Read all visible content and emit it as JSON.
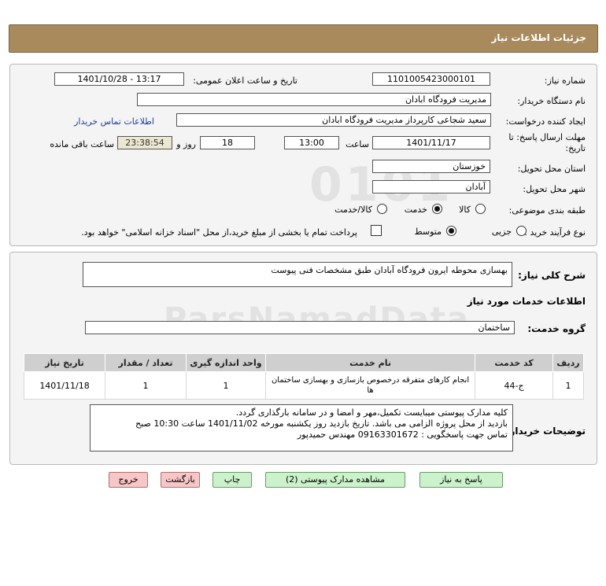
{
  "header": {
    "title": "جزئیات اطلاعات نیاز"
  },
  "form": {
    "need_number_label": "شماره نیاز:",
    "need_number": "1101005423000101",
    "announce_label": "تاریخ و ساعت اعلان عمومی:",
    "announce_value": "1401/10/28 - 13:17",
    "buyer_org_label": "نام دستگاه خریدار:",
    "buyer_org": "مدیریت فرودگاه ابادان",
    "creator_label": "ایجاد کننده درخواست:",
    "creator": "سعید شجاعی کارپرداز مدیریت فرودگاه ابادان",
    "contact_link": "اطلاعات تماس خریدار",
    "deadline_label_1": "مهلت ارسال پاسخ: تا",
    "deadline_label_2": "تاریخ:",
    "deadline_date": "1401/11/17",
    "time_label": "ساعت",
    "deadline_time": "13:00",
    "days_value": "18",
    "days_label": "روز و",
    "remaining_time": "23:38:54",
    "remaining_label": "ساعت باقی مانده",
    "province_label": "استان محل تحویل:",
    "province": "خوزستان",
    "city_label": "شهر محل تحویل:",
    "city": "آبادان",
    "category_label": "طبقه بندی موضوعی:",
    "category_options": [
      "کالا",
      "خدمت",
      "کالا/خدمت"
    ],
    "category_selected": "خدمت",
    "process_label": "نوع فرآیند خرید :",
    "process_options": [
      "جزیی",
      "متوسط"
    ],
    "process_selected": "متوسط",
    "payment_note": "پرداخت تمام یا بخشی از مبلغ خرید،از محل \"اسناد خزانه اسلامی\" خواهد بود."
  },
  "details": {
    "summary_label": "شرح کلی نیاز:",
    "summary": "بهسازی محوطه ایرون فرودگاه آبادان طبق مشخصات فنی پیوست",
    "services_title": "اطلاعات خدمات مورد نیاز",
    "service_group_label": "گروه خدمت:",
    "service_group": "ساختمان",
    "table": {
      "headers": [
        "ردیف",
        "کد خدمت",
        "نام خدمت",
        "واحد اندازه گیری",
        "تعداد / مقدار",
        "تاریخ نیاز"
      ],
      "rows": [
        [
          "1",
          "ج-44",
          "انجام کارهای متفرقه درخصوص بازسازی و بهسازی ساختمان ها",
          "1",
          "1",
          "1401/11/18"
        ]
      ]
    },
    "buyer_notes_label": "توضیحات خریدار:",
    "buyer_notes": [
      "کلیه مدارک پیوستی میبایست تکمیل،مهر و امضا و در سامانه بارگذاری گردد.",
      "بازدید از محل پروژه الزامی می باشد. تاریخ بازدید روز یکشنبه مورخه 1401/11/02 ساعت 10:30 صبح",
      "تماس جهت پاسخگویی : 09163301672 مهندس حمیدپور"
    ]
  },
  "buttons": {
    "reply": "پاسخ به نیاز",
    "view_docs": "مشاهده مدارک پیوستی (2)",
    "print": "چاپ",
    "back": "بازگشت",
    "exit": "خروج"
  },
  "watermark": {
    "text": "ParsNamadData",
    "digits": "0101"
  }
}
